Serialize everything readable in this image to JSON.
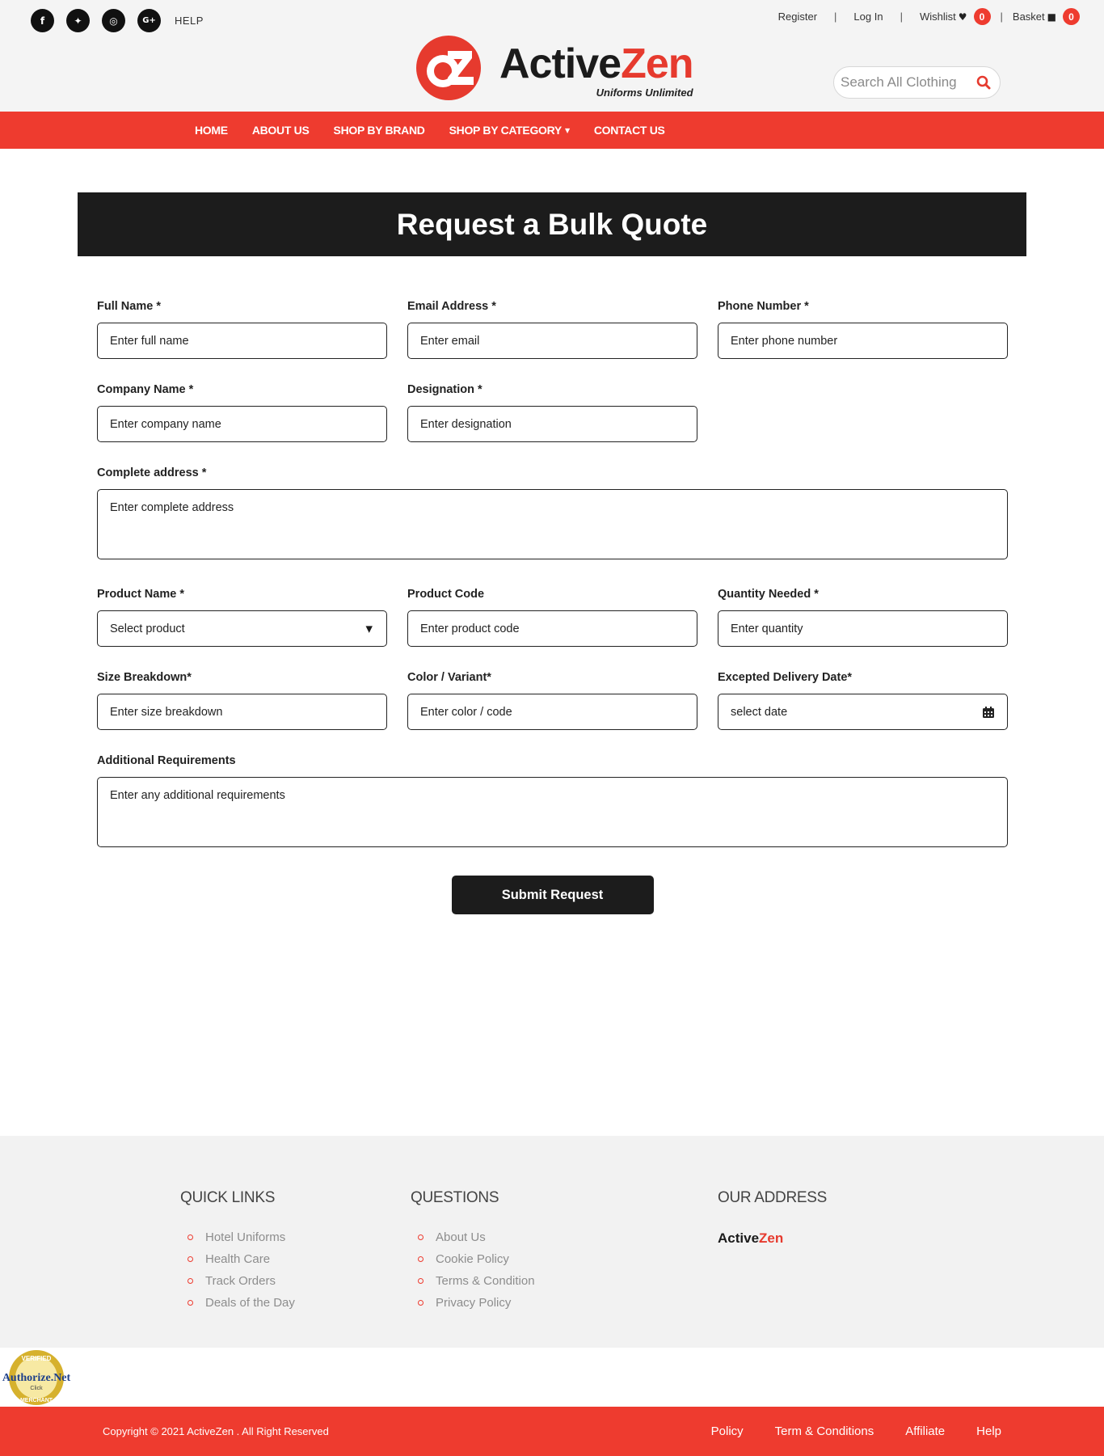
{
  "header": {
    "social": [
      {
        "icon": "facebook-icon",
        "glyph": "f"
      },
      {
        "icon": "twitter-icon",
        "glyph": "✦"
      },
      {
        "icon": "instagram-icon",
        "glyph": "◎"
      },
      {
        "icon": "google-plus-icon",
        "glyph": "G+"
      }
    ],
    "help": "HELP",
    "register": "Register",
    "login": "Log In",
    "wishlist": "Wishlist",
    "wishlist_count": "0",
    "basket": "Basket",
    "basket_count": "0",
    "separator": "|",
    "logo_name_1": "Active",
    "logo_name_2": "Zen",
    "logo_tagline": "Uniforms Unlimited",
    "search_placeholder": "Search All Clothing"
  },
  "nav": {
    "items": [
      "HOME",
      "ABOUT US",
      "SHOP BY BRAND",
      "SHOP BY CATEGORY",
      "CONTACT US"
    ]
  },
  "page": {
    "title": "Request a Bulk Quote"
  },
  "form": {
    "full_name": {
      "label": "Full Name *",
      "placeholder": "Enter full name"
    },
    "email": {
      "label": "Email Address *",
      "placeholder": "Enter email"
    },
    "phone": {
      "label": "Phone Number *",
      "placeholder": "Enter phone number"
    },
    "company": {
      "label": "Company Name *",
      "placeholder": "Enter company name"
    },
    "designation": {
      "label": "Designation *",
      "placeholder": "Enter designation"
    },
    "address": {
      "label": "Complete address *",
      "placeholder": "Enter complete address"
    },
    "product_name": {
      "label": "Product Name *",
      "selected": "Select product"
    },
    "product_code": {
      "label": "Product Code",
      "placeholder": "Enter product code"
    },
    "quantity": {
      "label": "Quantity Needed *",
      "placeholder": "Enter quantity"
    },
    "size": {
      "label": "Size Breakdown*",
      "placeholder": "Enter size breakdown"
    },
    "color": {
      "label": "Color / Variant*",
      "placeholder": "Enter color / code"
    },
    "delivery": {
      "label": "Excepted Delivery Date*",
      "placeholder": "select date"
    },
    "additional": {
      "label": "Additional Requirements",
      "placeholder": "Enter any additional requirements"
    },
    "submit_label": "Submit Request"
  },
  "footer": {
    "quick_links_heading": "QUICK LINKS",
    "quick_links": [
      "Hotel Uniforms",
      "Health Care",
      "Track Orders",
      "Deals of the Day"
    ],
    "questions_heading": "QUESTIONS",
    "questions": [
      "About Us",
      "Cookie Policy",
      "Terms & Condition",
      "Privacy Policy"
    ],
    "address_heading": "OUR ADDRESS",
    "brand_1": "Active",
    "brand_2": "Zen",
    "seal_text_1": "VERIFIED",
    "seal_text_2": "Authorize.Net",
    "seal_text_3": "Click",
    "seal_text_4": "MERCHANT",
    "copyright": "Copyright © 2021 ActiveZen . All Right Reserved",
    "bottom_links": [
      "Policy",
      "Term & Conditions",
      "Affiliate",
      "Help"
    ]
  },
  "colors": {
    "brand_red": "#ee3b2f",
    "dark": "#1c1c1c",
    "footer_bg": "#f2f2f2"
  }
}
